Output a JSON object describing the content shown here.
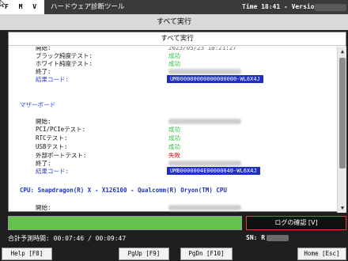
{
  "titlebar": {
    "logo": "F M V",
    "app_name": "ハードウェア診断ツール",
    "time_version": "Time 18:41 - Version"
  },
  "header": {
    "title": "すべて実行"
  },
  "panel": {
    "title": "すべて実行"
  },
  "rows": [
    {
      "label": "開始:",
      "value": "2023/05/23 10:21:27",
      "status": "ts"
    },
    {
      "label": "ブラック純度テスト:",
      "value": "成功",
      "status": "ok"
    },
    {
      "label": "ホワイト純度テスト:",
      "value": "成功",
      "status": "ok"
    },
    {
      "label": "終了:",
      "value": "",
      "status": "blur"
    },
    {
      "label": "結果コード:",
      "value": "UM000000000000000000-WL6X4J",
      "status": "code"
    },
    {
      "label": "マザーボード",
      "value": "",
      "status": "section"
    },
    {
      "label": "開始:",
      "value": "",
      "status": "blur"
    },
    {
      "label": "PCI/PCIeテスト:",
      "value": "成功",
      "status": "ok"
    },
    {
      "label": "RTCテスト:",
      "value": "成功",
      "status": "ok"
    },
    {
      "label": "USBテスト:",
      "value": "成功",
      "status": "ok"
    },
    {
      "label": "外部ポートテスト:",
      "value": "失敗",
      "status": "ng"
    },
    {
      "label": "終了:",
      "value": "",
      "status": "blur"
    },
    {
      "label": "結果コード:",
      "value": "UMB0000004E00000040-WL6X4J",
      "status": "code"
    },
    {
      "label": "CPU: Snapdragon(R) X - X126100 - Qualcomm(R) Oryon(TM) CPU",
      "value": "",
      "status": "cpu"
    },
    {
      "label": "開始:",
      "value": "",
      "status": "blur"
    },
    {
      "label": "終了:",
      "value": "",
      "status": "blur"
    }
  ],
  "progress": {
    "fill_fraction": 1.0
  },
  "log_button": {
    "label": "ログの確認 [V]"
  },
  "status": {
    "estimate_label": "合計予測時間:",
    "estimate_value": "00:07:46 / 00:09:47",
    "sn_label": "SN: R"
  },
  "footer": {
    "help": "Help [F8]",
    "pgup": "PgUp [F9]",
    "pgdn": "PgDn [F10]",
    "home": "Home [Esc]"
  }
}
